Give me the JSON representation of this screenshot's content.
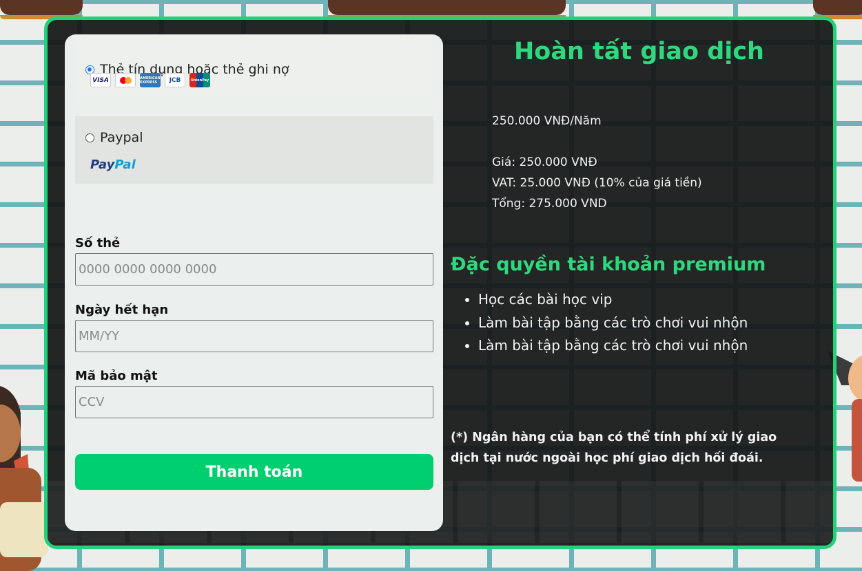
{
  "colors": {
    "accent": "#2fd87e",
    "button": "#00cf6f",
    "panel": "#141616",
    "border": "#1fd37a"
  },
  "payment_methods": [
    {
      "label": "Thẻ tín dụng hoặc thẻ ghi nợ",
      "selected": true,
      "logos": [
        "VISA",
        "mastercard-icon",
        "AMERICAN EXPRESS",
        "JCB",
        "UnionPay"
      ]
    },
    {
      "label": "Paypal",
      "selected": false,
      "logo": {
        "pay": "Pay",
        "pal": "Pal"
      }
    }
  ],
  "form": {
    "card_number": {
      "label": "Số thẻ",
      "placeholder": "0000 0000 0000 0000"
    },
    "expiry": {
      "label": "Ngày hết hạn",
      "placeholder": "MM/YY"
    },
    "security": {
      "label": "Mã bảo mật",
      "placeholder": "CCV"
    },
    "submit_label": "Thanh toán"
  },
  "summary": {
    "title": "Hoàn tất giao dịch",
    "plan": "250.000 VNĐ/Năm",
    "price": "Giá: 250.000 VNĐ",
    "vat": "VAT: 25.000 VNĐ (10% của giá tiền)",
    "total": "Tổng: 275.000 VND"
  },
  "premium": {
    "title": "Đặc quyền tài khoản premium",
    "benefits": [
      "Học các bài học vip",
      "Làm bài tập bằng các trò chơi vui nhộn",
      "Làm bài tập bằng các trò chơi vui nhộn"
    ]
  },
  "note": "(*) Ngân hàng của bạn có thể tính phí xử lý giao dịch tại nước ngoài học phí giao dịch hối đoái."
}
